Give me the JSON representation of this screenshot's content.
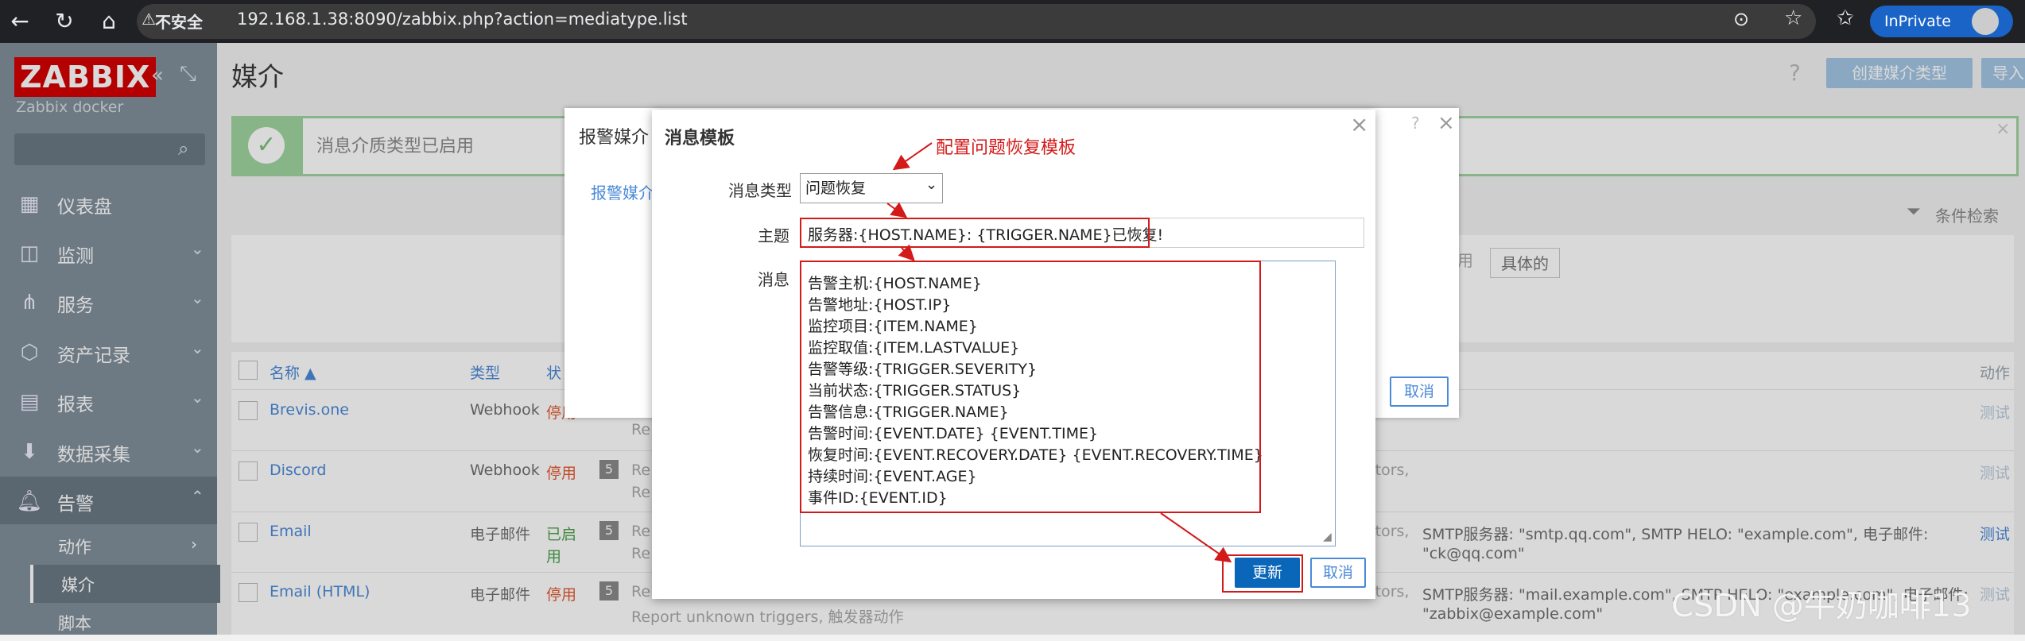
{
  "browser": {
    "not_secure": "不安全",
    "url": "192.168.1.38:8090/zabbix.php?action=mediatype.list",
    "inprivate": "InPrivate"
  },
  "sidebar": {
    "logo": "ZABBIX",
    "subtitle": "Zabbix docker",
    "items": [
      {
        "label": "仪表盘",
        "icon": "dashboard-icon"
      },
      {
        "label": "监测",
        "icon": "monitoring-icon"
      },
      {
        "label": "服务",
        "icon": "services-icon"
      },
      {
        "label": "资产记录",
        "icon": "inventory-icon"
      },
      {
        "label": "报表",
        "icon": "reports-icon"
      },
      {
        "label": "数据采集",
        "icon": "data-collection-icon"
      },
      {
        "label": "告警",
        "icon": "bell-icon"
      }
    ],
    "subitems": [
      {
        "label": "动作"
      },
      {
        "label": "媒介"
      },
      {
        "label": "脚本"
      }
    ]
  },
  "header": {
    "title": "媒介",
    "create_label": "创建媒介类型",
    "import_label": "导入",
    "help": "?"
  },
  "banner": {
    "text": "消息介质类型已启用",
    "close": "×"
  },
  "filter": {
    "tab_label": "条件检索",
    "seg_used": "用",
    "seg_specific": "具体的"
  },
  "table": {
    "headers": {
      "name": "名称 ▲",
      "type": "类型",
      "status": "状",
      "actions": "动作"
    },
    "rows": [
      {
        "name": "Brevis.one",
        "type": "Webhook",
        "status": "停用",
        "badge": "",
        "desc": "Re",
        "details": "",
        "details2": "",
        "test": "测试"
      },
      {
        "name": "Discord",
        "type": "Webhook",
        "status": "停用",
        "badge": "5",
        "desc": "Re",
        "desc2": "Re",
        "extra": "ators,",
        "details": "",
        "details2": "",
        "test": "测试"
      },
      {
        "name": "Email",
        "type": "电子邮件",
        "status": "已启",
        "status2": "用",
        "badge": "5",
        "desc": "Re",
        "desc2": "Re",
        "extra": "ators,",
        "details": "SMTP服务器: \"smtp.qq.com\", SMTP HELO: \"example.com\", 电子邮件:",
        "details2": "\"ck@qq.com\"",
        "test": "测试"
      },
      {
        "name": "Email (HTML)",
        "type": "电子邮件",
        "status": "停用",
        "badge": "5",
        "desc": "Re",
        "desc2": "Report unknown triggers, 触发器动作",
        "extra": "ators,",
        "details": "SMTP服务器: \"mail.example.com\", SMTP HELO: \"example.com\", 电子邮件:",
        "details2": "\"zabbix@example.com\"",
        "test": "测试"
      }
    ]
  },
  "back_dialog": {
    "title": "报警媒介",
    "tab": "报警媒介",
    "help": "?",
    "close": "×",
    "cancel": "取消"
  },
  "dialog": {
    "title": "消息模板",
    "close": "×",
    "annotation": "配置问题恢复模板",
    "msgtype_label": "消息类型",
    "msgtype_value": "问题恢复",
    "subject_label": "主题",
    "subject_value": "服务器:{HOST.NAME}: {TRIGGER.NAME}已恢复!",
    "message_label": "消息",
    "message_lines": [
      "告警主机:{HOST.NAME}",
      "告警地址:{HOST.IP}",
      "监控项目:{ITEM.NAME}",
      "监控取值:{ITEM.LASTVALUE}",
      "告警等级:{TRIGGER.SEVERITY}",
      "当前状态:{TRIGGER.STATUS}",
      "告警信息:{TRIGGER.NAME}",
      "告警时间:{EVENT.DATE} {EVENT.TIME}",
      "恢复时间:{EVENT.RECOVERY.DATE} {EVENT.RECOVERY.TIME}",
      "持续时间:{EVENT.AGE}",
      "事件ID:{EVENT.ID}"
    ],
    "update_label": "更新",
    "cancel_label": "取消"
  },
  "watermark": "CSDN @牛奶咖啡13",
  "colors": {
    "zabbix_red": "#d40000",
    "primary": "#0a66b8",
    "annotation": "#d41919",
    "sidebar": "#808f9a"
  }
}
